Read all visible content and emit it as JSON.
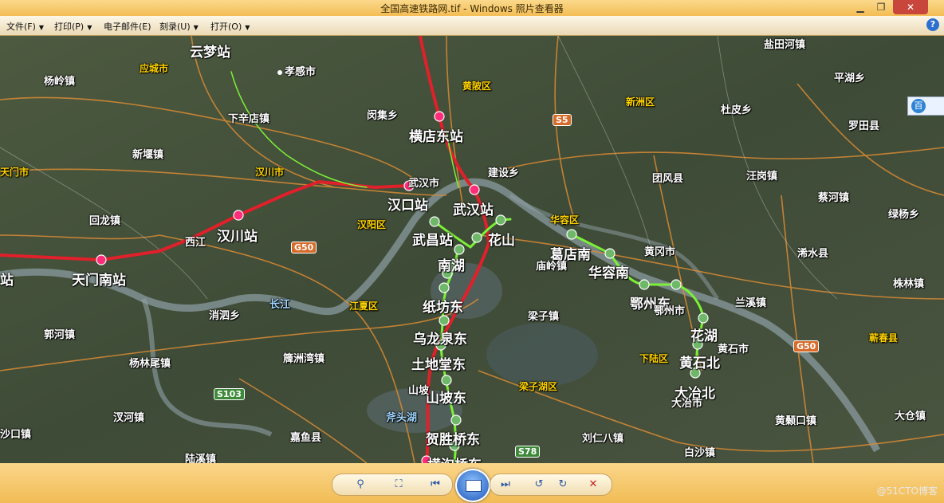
{
  "window": {
    "title": "全国高速铁路网.tif - Windows 照片查看器",
    "minimize_glyph": "▁",
    "maximize_glyph": "❐",
    "close_glyph": "✕"
  },
  "menu": [
    {
      "label": "文件(F)"
    },
    {
      "label": "打印(P)"
    },
    {
      "label": "电子邮件(E)"
    },
    {
      "label": "刻录(U)"
    },
    {
      "label": "打开(O)"
    }
  ],
  "menu_arrow": "▼",
  "help_glyph": "?",
  "map": {
    "stations": [
      "云梦站",
      "横店东站",
      "汉口站",
      "武汉站",
      "武昌站",
      "花山",
      "汉川站",
      "天门南站",
      "葛店南",
      "华容南",
      "鄂州东",
      "花湖",
      "黄石北",
      "大冶北",
      "南湖",
      "纸坊东",
      "乌龙泉东",
      "土地堂东",
      "山坡东",
      "贺胜桥东",
      "横沟桥东",
      "站"
    ],
    "places": [
      "孝感市",
      "应城市",
      "杨岭镇",
      "下辛店镇",
      "闵集乡",
      "新堰镇",
      "汉川市",
      "天门市",
      "回龙镇",
      "西江",
      "黄陂区",
      "新洲区",
      "武汉市",
      "汉阳区",
      "建设乡",
      "团风县",
      "华容区",
      "黄冈市",
      "庙岭镇",
      "鄂州市",
      "浠水县",
      "兰溪镇",
      "株林镇",
      "罗田县",
      "杜皮乡",
      "汪岗镇",
      "蔡河镇",
      "绿杨乡",
      "平湖乡",
      "盐田河镇",
      "黄石市",
      "下陆区",
      "大冶市",
      "蕲春县",
      "江夏区",
      "梁子湖区",
      "梁子镇",
      "消泗乡",
      "郭河镇",
      "簰洲湾镇",
      "杨林尾镇",
      "汊河镇",
      "沙口镇",
      "陆溪镇",
      "嘉鱼县",
      "山坡",
      "刘仁八镇",
      "白沙镇",
      "黄颡口镇",
      "大仓镇",
      "长江",
      "斧头湖"
    ],
    "highways": [
      "S5",
      "G50",
      "G50",
      "S103",
      "S78"
    ]
  },
  "side_widget": {
    "label": "百",
    "icon": "baidu-icon"
  },
  "toolbar": {
    "zoom_glyph": "⚲",
    "fit_glyph": "⛶",
    "prev_glyph": "⏮",
    "next_glyph": "⏭",
    "rotate_ccw_glyph": "↺",
    "rotate_cw_glyph": "↻",
    "delete_glyph": "✕"
  },
  "watermark": "@51CTO博客",
  "colors": {
    "titlebar": "#f3bd55",
    "red_line": "#e0202a",
    "green_line": "#7cf038",
    "station_red": "#ff2d7a",
    "station_green": "#6fb86a"
  }
}
